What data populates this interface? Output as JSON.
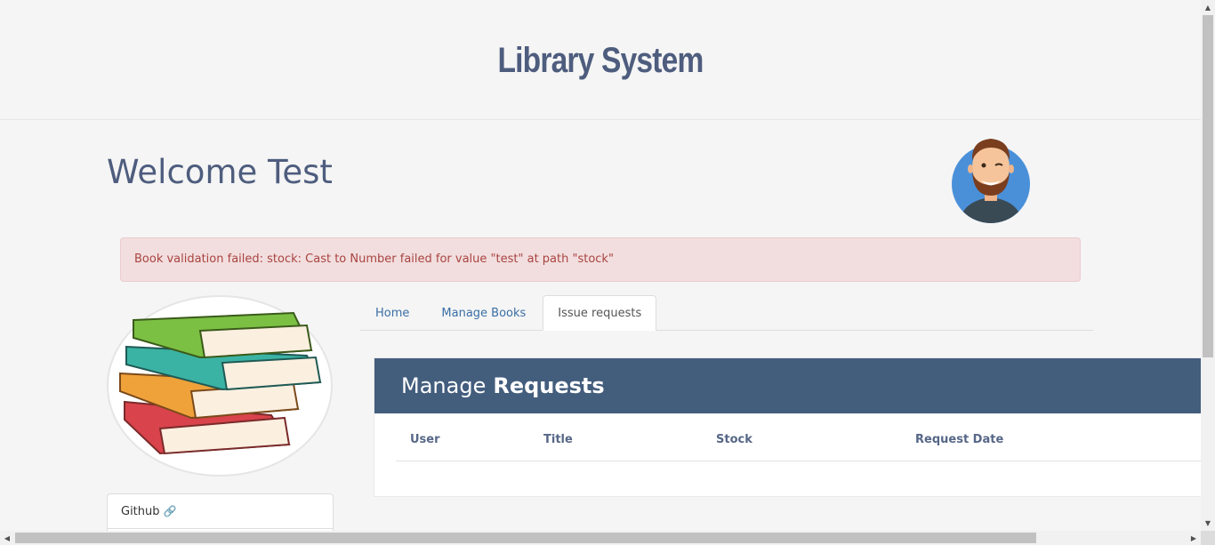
{
  "header": {
    "title": "Library System"
  },
  "welcome": {
    "text": "Welcome Test"
  },
  "alert": {
    "message": "Book validation failed: stock: Cast to Number failed for value \"test\" at path \"stock\""
  },
  "sidebar": {
    "links": [
      {
        "label": "Github"
      }
    ]
  },
  "tabs": [
    {
      "label": "Home",
      "active": false
    },
    {
      "label": "Manage Books",
      "active": false
    },
    {
      "label": "Issue requests",
      "active": true
    }
  ],
  "requests": {
    "title_prefix": "Manage",
    "title_strong": "Requests",
    "columns": [
      "User",
      "Title",
      "Stock",
      "Request Date"
    ]
  },
  "colors": {
    "header_text": "#4e5d7e",
    "card_header": "#435d7d",
    "alert_bg": "#f2dede",
    "alert_text": "#a94442",
    "tab_link": "#3a6ea5"
  }
}
